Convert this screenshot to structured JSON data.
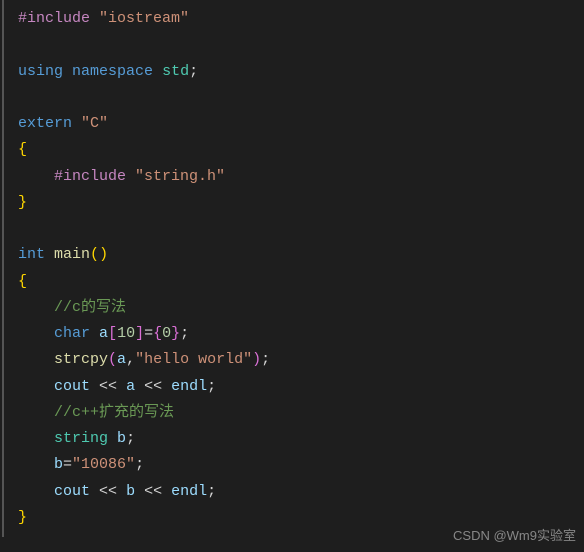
{
  "code": {
    "l1_include": "#include",
    "l1_header": "\"iostream\"",
    "l3_using": "using",
    "l3_namespace": "namespace",
    "l3_std": "std",
    "l3_semi": ";",
    "l5_extern": "extern",
    "l5_c": "\"C\"",
    "l6_brace": "{",
    "l7_include": "#include",
    "l7_header": "\"string.h\"",
    "l8_brace": "}",
    "l10_int": "int",
    "l10_main": "main",
    "l10_p1": "(",
    "l10_p2": ")",
    "l11_brace": "{",
    "l12_comment": "//c的写法",
    "l13_char": "char",
    "l13_a": "a",
    "l13_bo": "[",
    "l13_ten": "10",
    "l13_bc": "]",
    "l13_eq": "=",
    "l13_bro": "{",
    "l13_zero": "0",
    "l13_brc": "}",
    "l13_semi": ";",
    "l14_strcpy": "strcpy",
    "l14_po": "(",
    "l14_a": "a",
    "l14_comma": ",",
    "l14_str": "\"hello world\"",
    "l14_pc": ")",
    "l14_semi": ";",
    "l15_cout": "cout",
    "l15_op1": "<<",
    "l15_a": "a",
    "l15_op2": "<<",
    "l15_endl": "endl",
    "l15_semi": ";",
    "l16_comment": "//c++扩充的写法",
    "l17_string": "string",
    "l17_b": "b",
    "l17_semi": ";",
    "l18_b": "b",
    "l18_eq": "=",
    "l18_str": "\"10086\"",
    "l18_semi": ";",
    "l19_cout": "cout",
    "l19_op1": "<<",
    "l19_b": "b",
    "l19_op2": "<<",
    "l19_endl": "endl",
    "l19_semi": ";",
    "l20_brace": "}"
  },
  "watermark": "CSDN @Wm9实验室"
}
